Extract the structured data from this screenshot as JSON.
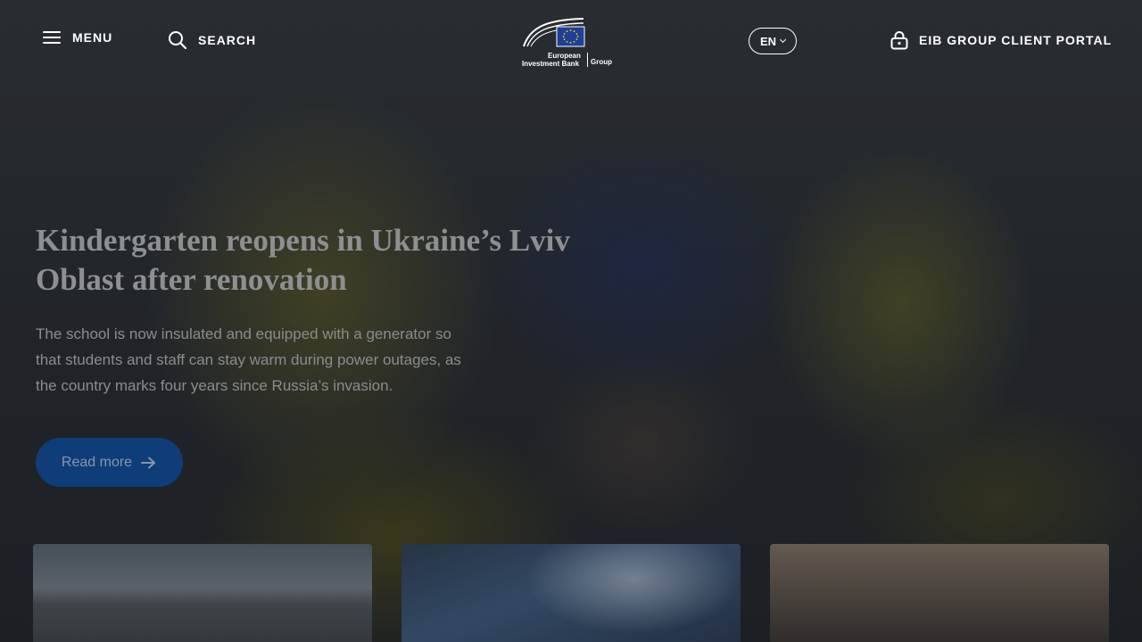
{
  "header": {
    "menu_label": "MENU",
    "search_label": "SEARCH",
    "logo": {
      "line1": "European",
      "line2": "Investment Bank",
      "group": "Group"
    },
    "language": "EN",
    "portal_label": "EIB GROUP CLIENT PORTAL"
  },
  "hero": {
    "title": "Kindergarten reopens in Ukraine’s Lviv Oblast after renovation",
    "description": "The school is now insulated and equipped with a generator so that students and staff can stay warm during power outages, as the country marks four years since Russia’s invasion.",
    "cta_label": "Read more"
  },
  "colors": {
    "primary_button": "#0f3d78",
    "header_text": "#ffffff",
    "eu_flag_blue": "#1f3f99",
    "eu_flag_star": "#ffdd00"
  },
  "icons": {
    "menu": "hamburger-icon",
    "search": "search-icon",
    "language_chevron": "chevron-down-icon",
    "portal": "lock-icon",
    "cta_arrow": "arrow-right-icon"
  }
}
